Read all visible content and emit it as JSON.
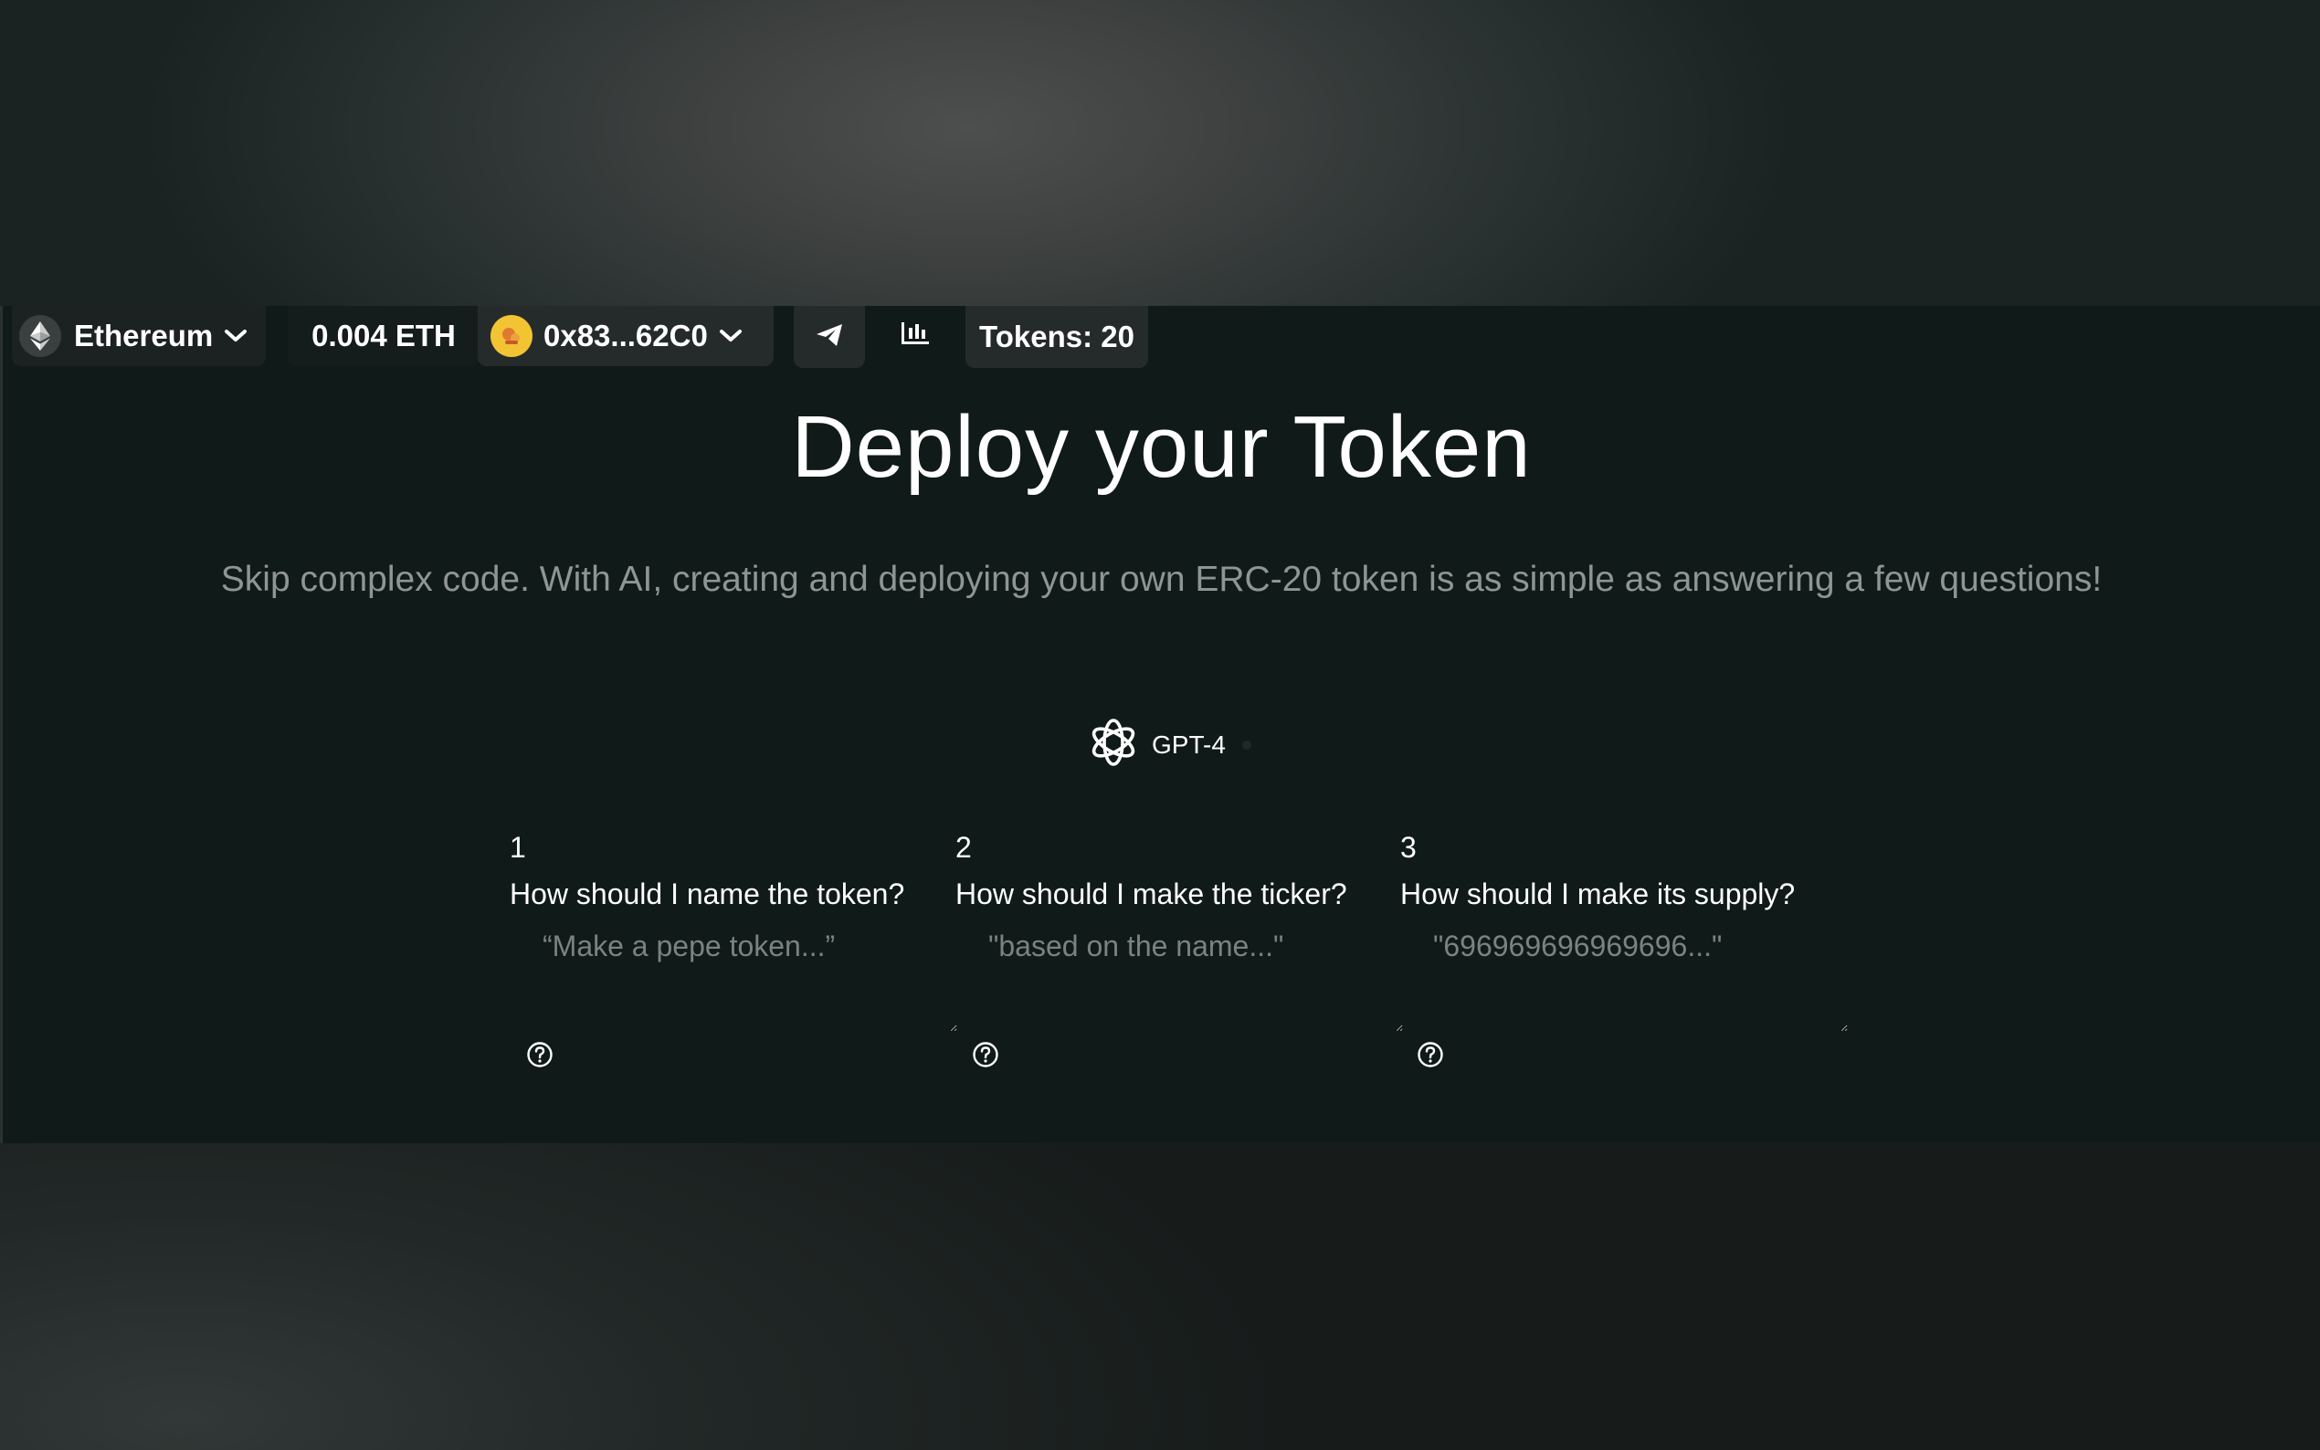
{
  "topbar": {
    "network": {
      "label": "Ethereum",
      "icon": "ethereum-icon"
    },
    "balance": "0.004 ETH",
    "account": {
      "address": "0x83...62C0",
      "avatar_color": "#f2c434"
    },
    "telegram_icon": "telegram-icon",
    "stats_icon": "bar-chart-icon",
    "tokens": "Tokens: 20"
  },
  "hero": {
    "title": "Deploy your Token",
    "subtitle": "Skip complex code. With AI, creating and deploying your own ERC-20 token is as simple as answering a few questions!"
  },
  "model": {
    "label": "GPT-4",
    "icon": "openai-icon"
  },
  "questions": [
    {
      "number": "1",
      "label": "How should I name the token?",
      "placeholder": "“Make a pepe token...”"
    },
    {
      "number": "2",
      "label": "How should I make the ticker?",
      "placeholder": "\"based on the name...\""
    },
    {
      "number": "3",
      "label": "How should I make its supply?",
      "placeholder": "\"696969696969696...\""
    }
  ],
  "colors": {
    "app_bg": "#101a19",
    "pill_bg": "#252b2a",
    "muted_text": "#8f9594"
  }
}
